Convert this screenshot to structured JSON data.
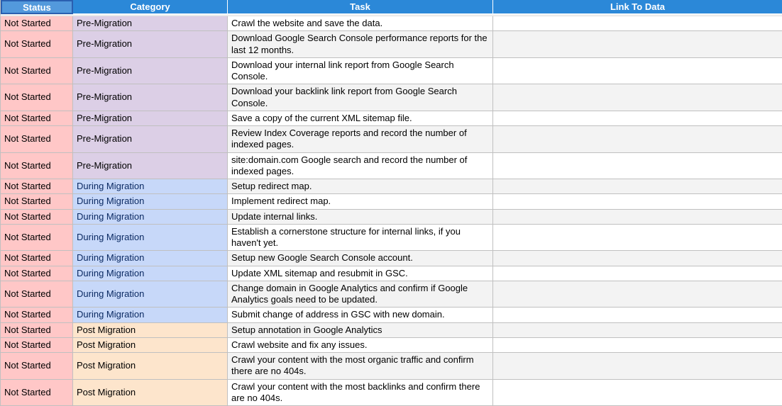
{
  "headers": {
    "status": "Status",
    "category": "Category",
    "task": "Task",
    "link": "Link To Data"
  },
  "categoryStyles": {
    "Pre-Migration": "cat-pre",
    "During Migration": "cat-during",
    "Post Migration": "cat-post"
  },
  "rows": [
    {
      "status": "Not Started",
      "category": "Pre-Migration",
      "task": "Crawl the website and save the data.",
      "link": ""
    },
    {
      "status": "Not Started",
      "category": "Pre-Migration",
      "task": "Download Google Search Console performance reports for the last 12 months.",
      "link": ""
    },
    {
      "status": "Not Started",
      "category": "Pre-Migration",
      "task": "Download your internal link report from Google Search Console.",
      "link": ""
    },
    {
      "status": "Not Started",
      "category": "Pre-Migration",
      "task": "Download your backlink link report from Google Search Console.",
      "link": ""
    },
    {
      "status": "Not Started",
      "category": "Pre-Migration",
      "task": "Save a copy of the current XML sitemap file.",
      "link": ""
    },
    {
      "status": "Not Started",
      "category": "Pre-Migration",
      "task": "Review Index Coverage reports and record the number of indexed pages.",
      "link": ""
    },
    {
      "status": "Not Started",
      "category": "Pre-Migration",
      "task": "site:domain.com Google search and record the number of indexed pages.",
      "link": ""
    },
    {
      "status": "Not Started",
      "category": "During Migration",
      "task": "Setup redirect map.",
      "link": ""
    },
    {
      "status": "Not Started",
      "category": "During Migration",
      "task": "Implement redirect map.",
      "link": ""
    },
    {
      "status": "Not Started",
      "category": "During Migration",
      "task": "Update internal links.",
      "link": ""
    },
    {
      "status": "Not Started",
      "category": "During Migration",
      "task": "Establish a cornerstone structure for internal links, if you haven't yet.",
      "link": ""
    },
    {
      "status": "Not Started",
      "category": "During Migration",
      "task": "Setup new Google Search Console account.",
      "link": ""
    },
    {
      "status": "Not Started",
      "category": "During Migration",
      "task": "Update XML sitemap and resubmit in GSC.",
      "link": ""
    },
    {
      "status": "Not Started",
      "category": "During Migration",
      "task": "Change domain in Google Analytics and confirm if Google Analytics goals need to be updated.",
      "link": ""
    },
    {
      "status": "Not Started",
      "category": "During Migration",
      "task": "Submit change of address in GSC with new domain.",
      "link": ""
    },
    {
      "status": "Not Started",
      "category": "Post Migration",
      "task": "Setup annotation in Google Analytics",
      "link": ""
    },
    {
      "status": "Not Started",
      "category": "Post Migration",
      "task": "Crawl website and fix any issues.",
      "link": ""
    },
    {
      "status": "Not Started",
      "category": "Post Migration",
      "task": "Crawl your content with the most organic traffic and confirm there are no 404s.",
      "link": ""
    },
    {
      "status": "Not Started",
      "category": "Post Migration",
      "task": "Crawl your content with the most backlinks and confirm there are no 404s.",
      "link": ""
    }
  ]
}
